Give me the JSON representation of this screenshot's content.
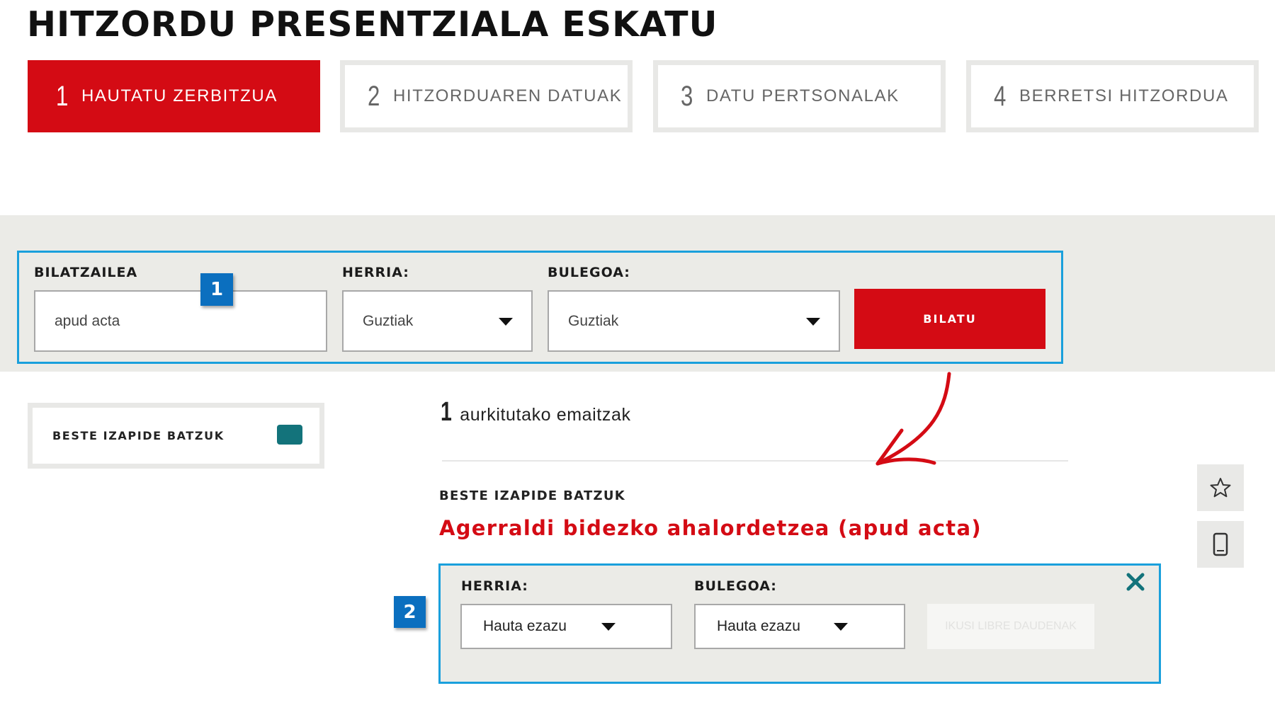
{
  "page": {
    "title": "HITZORDU PRESENTZIALA ESKATU"
  },
  "steps": [
    {
      "number": "1",
      "label": "HAUTATU ZERBITZUA",
      "active": true
    },
    {
      "number": "2",
      "label": "HITZORDUAREN DATUAK",
      "active": false
    },
    {
      "number": "3",
      "label": "DATU PERTSONALAK",
      "active": false
    },
    {
      "number": "4",
      "label": "BERRETSI HITZORDUA",
      "active": false
    }
  ],
  "search": {
    "searcher_label": "BILATZAILEA",
    "searcher_value": "apud acta",
    "town_label": "HERRIA:",
    "town_value": "Guztiak",
    "office_label": "BULEGOA:",
    "office_value": "Guztiak",
    "button_label": "BILATU"
  },
  "callouts": {
    "first": "1",
    "second": "2"
  },
  "filter": {
    "label": "BESTE IZAPIDE BATZUK",
    "color": "#13737b"
  },
  "results": {
    "count": "1",
    "count_text": "aurkitutako emaitzak",
    "category": "BESTE IZAPIDE BATZUK",
    "title": "Agerraldi bidezko ahalordetzea (apud acta)"
  },
  "appointment": {
    "town_label": "HERRIA:",
    "town_value": "Hauta ezazu",
    "office_label": "BULEGOA:",
    "office_value": "Hauta ezazu",
    "button_label": "IKUSI LIBRE DAUDENAK"
  },
  "icons": {
    "close": "close-icon",
    "favorite": "star-icon",
    "mobile": "mobile-phone-icon",
    "arrow": "curved-arrow-icon"
  },
  "colors": {
    "brand_red": "#d40b14",
    "callout_blue": "#1aa0dc",
    "badge_blue": "#0b6fbf",
    "teal": "#13737b",
    "band_gray": "#ebebe7"
  }
}
